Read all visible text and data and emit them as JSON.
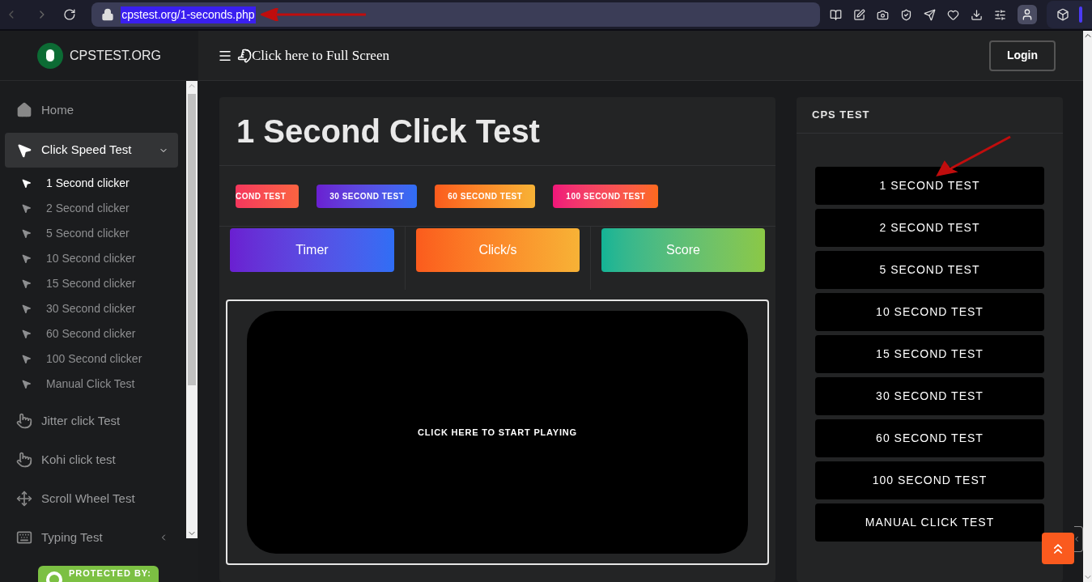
{
  "browser": {
    "url": "cpstest.org/1-seconds.php"
  },
  "sidebar": {
    "logo_text": "CPSTEST.ORG",
    "items": [
      {
        "kind": "home",
        "label": "Home",
        "selected": false
      },
      {
        "kind": "pointer",
        "label": "Click Speed Test",
        "selected": true,
        "expanded": true,
        "children": [
          {
            "label": "1 Second clicker",
            "selected": true
          },
          {
            "label": "2 Second clicker",
            "selected": false
          },
          {
            "label": "5 Second clicker",
            "selected": false
          },
          {
            "label": "10 Second clicker",
            "selected": false
          },
          {
            "label": "15 Second clicker",
            "selected": false
          },
          {
            "label": "30 Second clicker",
            "selected": false
          },
          {
            "label": "60 Second clicker",
            "selected": false
          },
          {
            "label": "100 Second clicker",
            "selected": false
          },
          {
            "label": "Manual Click Test",
            "selected": false
          }
        ]
      },
      {
        "kind": "hand",
        "label": "Jitter click Test",
        "selected": false
      },
      {
        "kind": "hand",
        "label": "Kohi click test",
        "selected": false
      },
      {
        "kind": "crosshair",
        "label": "Scroll Wheel Test",
        "selected": false
      },
      {
        "kind": "keyboard",
        "label": "Typing Test",
        "selected": false,
        "expanded": false
      }
    ],
    "badge": "PROTECTED BY:"
  },
  "header": {
    "full_screen_label": "Click here to Full Screen",
    "login": "Login"
  },
  "main": {
    "title": "1 Second Click Test",
    "test_buttons": [
      {
        "label": "COND TEST",
        "kind": "red"
      },
      {
        "label": "30 SECOND TEST",
        "kind": "purple"
      },
      {
        "label": "60 SECOND TEST",
        "kind": "orange"
      },
      {
        "label": "100 SECOND TEST",
        "kind": "pink"
      }
    ],
    "stats": [
      {
        "label": "Timer",
        "kind": "purple"
      },
      {
        "label": "Click/s",
        "kind": "orange"
      },
      {
        "label": "Score",
        "kind": "green"
      }
    ],
    "play_area": "CLICK HERE TO START PLAYING"
  },
  "aside": {
    "title": "CPS TEST",
    "links": [
      "1 SECOND TEST",
      "2 SECOND TEST",
      "5 SECOND TEST",
      "10 SECOND TEST",
      "15 SECOND TEST",
      "30 SECOND TEST",
      "60 SECOND TEST",
      "100 SECOND TEST",
      "MANUAL CLICK TEST"
    ]
  }
}
